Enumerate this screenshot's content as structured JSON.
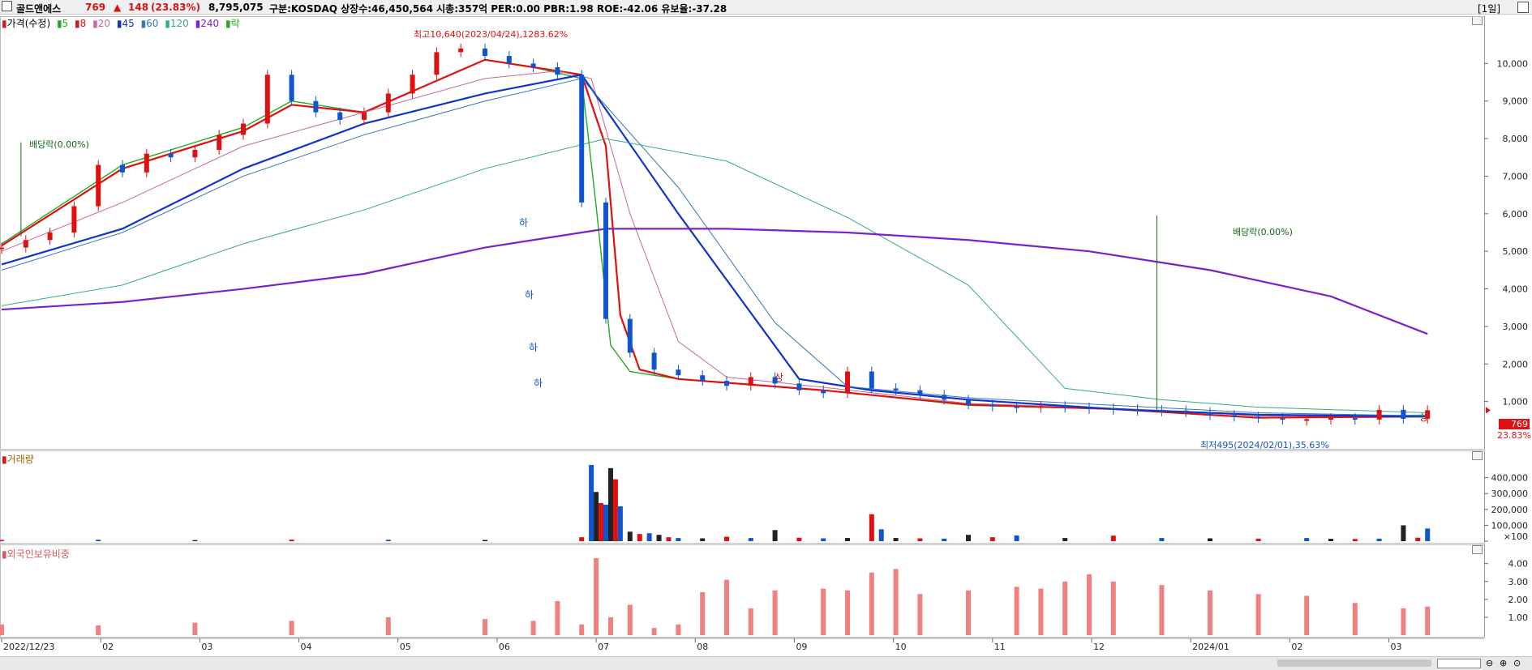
{
  "header": {
    "stock_name": "골드앤에스",
    "price": "769",
    "change_arrow": "▲",
    "change": "148",
    "change_pct": "(23.83%)",
    "volume": "8,795,075",
    "details": "구분:KOSDAQ 상장수:46,450,564 시총:357억 PER:0.00 PBR:1.98 ROE:-42.06 유보율:-37.28",
    "period": "[1일]"
  },
  "legend": {
    "price_label": "가격(수정)",
    "ma": [
      {
        "label": "5",
        "color": "#22aa22"
      },
      {
        "label": "8",
        "color": "#dd1111"
      },
      {
        "label": "20",
        "color": "#cc6699"
      },
      {
        "label": "45",
        "color": "#1133cc"
      },
      {
        "label": "60",
        "color": "#3377bb"
      },
      {
        "label": "120",
        "color": "#33aa88"
      },
      {
        "label": "240",
        "color": "#7722cc"
      }
    ],
    "event_label": "락"
  },
  "annotations": {
    "high": "최고10,640(2023/04/24),1283.62%",
    "low": "최저495(2024/02/01),35.63%",
    "dividend1": "배당락(0.00%)",
    "dividend2": "배당락(0.00%)",
    "limit_down": "하",
    "limit_up": "상",
    "last_price_tag": "769",
    "last_pct_tag": "23.83%"
  },
  "volume_panel": {
    "title": "거래량",
    "unit_label": "×100"
  },
  "foreign_panel": {
    "title": "외국인보유비중"
  },
  "colors": {
    "up": "#dd1111",
    "down": "#1155cc",
    "panel_border": "#bbbbbb"
  },
  "icons": [
    "panel-minimize-icon",
    "panel-close-icon",
    "zoom-out-icon",
    "zoom-in-icon",
    "zoom-reset-icon"
  ],
  "chart_data": [
    {
      "type": "line",
      "title": "가격(수정)",
      "ylim": [
        0,
        11000
      ],
      "y_ticks": [
        "1,000",
        "2,000",
        "3,000",
        "4,000",
        "5,000",
        "6,000",
        "7,000",
        "8,000",
        "9,000",
        "10,000"
      ],
      "x_ticks": [
        "2022/12/23",
        "02",
        "03",
        "04",
        "05",
        "06",
        "07",
        "08",
        "09",
        "10",
        "11",
        "12",
        "2024/01",
        "02",
        "03"
      ],
      "grid": true,
      "series": [
        {
          "name": "가격(수정)",
          "x": [
            0,
            5,
            10,
            15,
            20,
            25,
            30,
            35,
            40,
            45,
            50,
            55,
            60,
            65,
            70,
            75,
            80,
            85,
            90,
            95,
            100,
            105,
            110,
            115,
            120,
            125,
            130,
            135,
            140,
            145,
            150,
            155,
            160,
            165,
            170,
            175,
            180,
            185,
            190,
            195,
            200,
            205,
            210,
            215,
            220,
            225,
            230,
            235,
            240,
            245,
            250,
            255,
            260,
            265,
            270,
            275,
            280,
            285,
            290,
            295
          ],
          "values": [
            5100,
            5300,
            5500,
            6200,
            7300,
            7100,
            7600,
            7500,
            7700,
            8100,
            8400,
            9700,
            9000,
            8700,
            8500,
            8700,
            9200,
            9700,
            10300,
            10400,
            10200,
            10000,
            9900,
            9700,
            6300,
            3200,
            2300,
            1850,
            1700,
            1550,
            1420,
            1650,
            1480,
            1300,
            1220,
            1800,
            1350,
            1300,
            1180,
            1050,
            920,
            870,
            860,
            880,
            840,
            820,
            800,
            780,
            760,
            720,
            640,
            600,
            560,
            520,
            530,
            560,
            520,
            780,
            540,
            769
          ]
        },
        {
          "name": "5",
          "x": [
            0,
            25,
            50,
            60,
            75,
            100,
            110,
            120,
            123,
            126,
            130,
            140,
            170,
            200,
            230,
            260,
            295
          ],
          "values": [
            5200,
            7300,
            8300,
            9000,
            8700,
            10100,
            9900,
            9600,
            6200,
            2500,
            1800,
            1600,
            1300,
            900,
            800,
            560,
            640
          ]
        },
        {
          "name": "8",
          "x": [
            0,
            25,
            50,
            60,
            75,
            100,
            110,
            120,
            125,
            128,
            132,
            140,
            170,
            200,
            230,
            260,
            295
          ],
          "values": [
            5150,
            7200,
            8200,
            8900,
            8700,
            10100,
            9900,
            9700,
            7800,
            3300,
            1850,
            1600,
            1300,
            920,
            800,
            570,
            600
          ]
        },
        {
          "name": "20",
          "x": [
            0,
            25,
            50,
            75,
            100,
            115,
            122,
            130,
            140,
            150,
            170,
            200,
            230,
            260,
            295
          ],
          "values": [
            5000,
            6300,
            7800,
            8700,
            9600,
            9800,
            9600,
            6000,
            2600,
            1650,
            1380,
            950,
            820,
            620,
            600
          ]
        },
        {
          "name": "45",
          "x": [
            0,
            25,
            50,
            75,
            100,
            120,
            140,
            165,
            180,
            200,
            230,
            260,
            295
          ],
          "values": [
            4650,
            5600,
            7200,
            8400,
            9200,
            9700,
            6000,
            1600,
            1300,
            1050,
            800,
            650,
            600
          ]
        },
        {
          "name": "60",
          "x": [
            0,
            25,
            50,
            75,
            100,
            120,
            140,
            160,
            175,
            200,
            230,
            260,
            295
          ],
          "values": [
            4500,
            5500,
            7000,
            8100,
            9000,
            9600,
            6700,
            3100,
            1400,
            1100,
            900,
            700,
            620
          ]
        },
        {
          "name": "120",
          "x": [
            0,
            25,
            50,
            75,
            100,
            125,
            150,
            175,
            200,
            220,
            240,
            260,
            295
          ],
          "values": [
            3550,
            4100,
            5200,
            6100,
            7200,
            8000,
            7400,
            5900,
            4100,
            1350,
            1050,
            850,
            700
          ]
        },
        {
          "name": "240",
          "x": [
            0,
            25,
            50,
            75,
            100,
            125,
            150,
            175,
            200,
            225,
            250,
            275,
            295
          ],
          "values": [
            3450,
            3650,
            4000,
            4400,
            5100,
            5600,
            5600,
            5500,
            5300,
            5000,
            4500,
            3800,
            2800
          ]
        }
      ]
    },
    {
      "type": "bar",
      "title": "거래량",
      "ylim": [
        0,
        500000
      ],
      "y_ticks": [
        "×100",
        "100,000",
        "200,000",
        "300,000",
        "400,000"
      ],
      "series": [
        {
          "name": "거래량",
          "x": [
            0,
            20,
            40,
            60,
            80,
            100,
            120,
            122,
            123,
            124,
            125,
            126,
            127,
            128,
            130,
            132,
            134,
            136,
            138,
            140,
            145,
            150,
            155,
            160,
            165,
            170,
            175,
            180,
            182,
            185,
            190,
            195,
            200,
            205,
            210,
            220,
            230,
            240,
            250,
            260,
            270,
            275,
            280,
            285,
            290,
            293,
            295
          ],
          "values": [
            8000,
            9000,
            7000,
            10000,
            9000,
            8000,
            25000,
            480000,
            310000,
            240000,
            230000,
            460000,
            390000,
            220000,
            60000,
            45000,
            50000,
            40000,
            25000,
            20000,
            18000,
            28000,
            20000,
            70000,
            22000,
            18000,
            20000,
            170000,
            75000,
            20000,
            18000,
            16000,
            40000,
            25000,
            36000,
            20000,
            35000,
            20000,
            18000,
            16000,
            20000,
            15000,
            14000,
            16000,
            100000,
            22000,
            80000
          ]
        }
      ]
    },
    {
      "type": "bar",
      "title": "외국인보유비중",
      "ylim": [
        0,
        4.8
      ],
      "y_ticks": [
        "1.00",
        "2.00",
        "3.00",
        "4.00"
      ],
      "series": [
        {
          "name": "외국인보유비중",
          "x": [
            0,
            20,
            40,
            60,
            80,
            100,
            110,
            115,
            120,
            123,
            126,
            130,
            135,
            140,
            145,
            150,
            155,
            160,
            170,
            175,
            180,
            185,
            190,
            200,
            210,
            215,
            220,
            225,
            230,
            240,
            250,
            260,
            270,
            280,
            290,
            295
          ],
          "values": [
            0.6,
            0.55,
            0.7,
            0.8,
            1.0,
            0.9,
            0.8,
            1.9,
            0.6,
            4.3,
            1.0,
            1.7,
            0.4,
            0.6,
            2.4,
            3.1,
            1.5,
            2.5,
            2.6,
            2.5,
            3.5,
            3.7,
            2.3,
            2.5,
            2.7,
            2.6,
            3.0,
            3.4,
            3.0,
            2.8,
            2.5,
            2.3,
            2.2,
            1.8,
            1.5,
            1.6
          ]
        }
      ]
    }
  ]
}
